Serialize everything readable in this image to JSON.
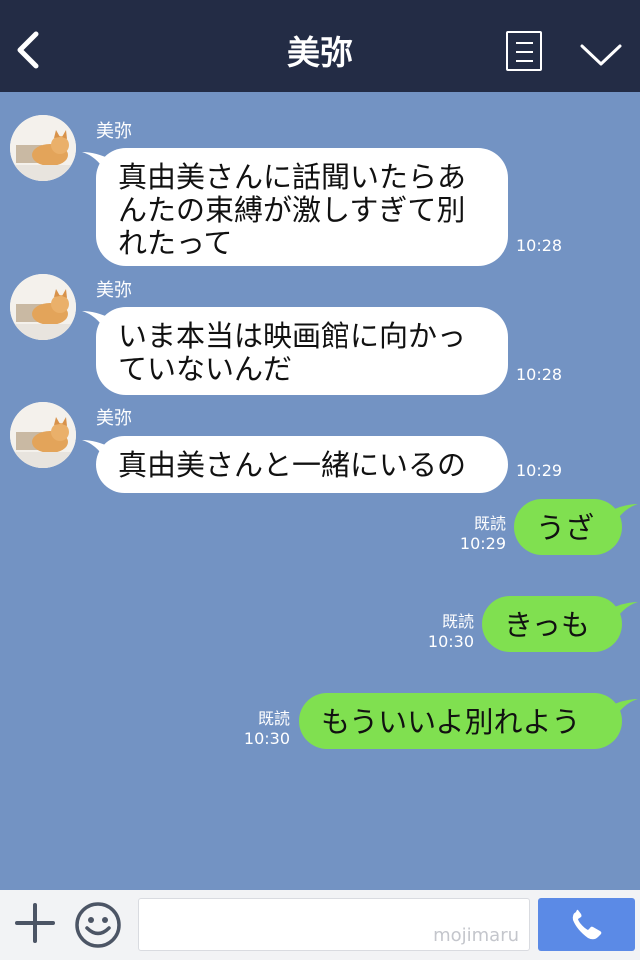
{
  "header": {
    "title": "美弥"
  },
  "messages": [
    {
      "sender": "美弥",
      "lines": [
        "真由美さんに話聞いたらあ",
        "んたの束縛が激しすぎて別",
        "れたって"
      ],
      "time": "10:28"
    },
    {
      "sender": "美弥",
      "lines": [
        "いま本当は映画館に向かっ",
        "ていないんだ"
      ],
      "time": "10:28"
    },
    {
      "sender": "美弥",
      "lines": [
        "真由美さんと一緒にいるの"
      ],
      "time": "10:29"
    },
    {
      "text": "うざ",
      "read": "既読",
      "time": "10:29"
    },
    {
      "text": "きっも",
      "read": "既読",
      "time": "10:30"
    },
    {
      "text": "もういいよ別れよう",
      "read": "既読",
      "time": "10:30"
    }
  ],
  "footer": {
    "watermark": "mojimaru"
  },
  "colors": {
    "header_bg": "#232c45",
    "chat_bg": "#7393c3",
    "incoming_bubble": "#ffffff",
    "outgoing_bubble": "#80e050",
    "call_button": "#5b8ae6"
  },
  "icons": [
    "chevron-left-icon",
    "menu-lines-icon",
    "chevron-down-icon",
    "plus-icon",
    "emoji-icon",
    "phone-icon"
  ]
}
